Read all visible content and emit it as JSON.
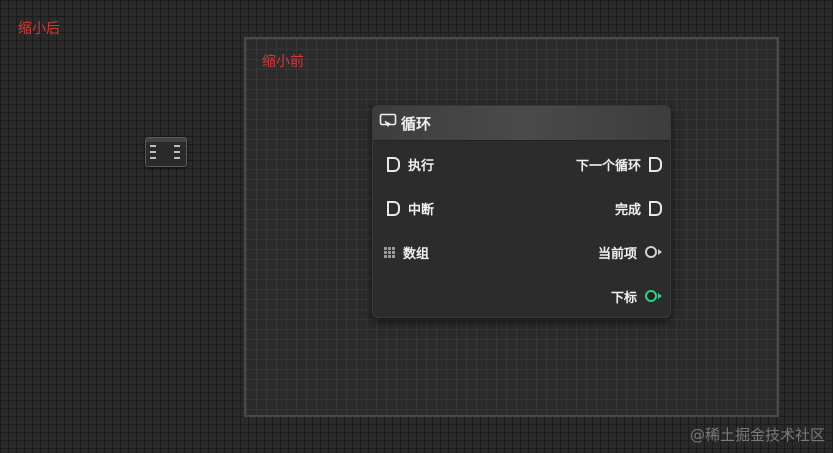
{
  "labels": {
    "after": "缩小后",
    "before": "缩小前"
  },
  "node": {
    "title": "循环",
    "title_icon": "loop-icon",
    "inputs": [
      {
        "label": "执行",
        "pin": "exec"
      },
      {
        "label": "中断",
        "pin": "exec"
      },
      {
        "label": "数组",
        "pin": "array"
      }
    ],
    "outputs": [
      {
        "label": "下一个循环",
        "pin": "exec"
      },
      {
        "label": "完成",
        "pin": "exec"
      },
      {
        "label": "当前项",
        "pin": "value",
        "color": "#d0d0d0"
      },
      {
        "label": "下标",
        "pin": "value",
        "color": "#2fd28a"
      }
    ]
  },
  "watermark": "@稀土掘金技术社区"
}
